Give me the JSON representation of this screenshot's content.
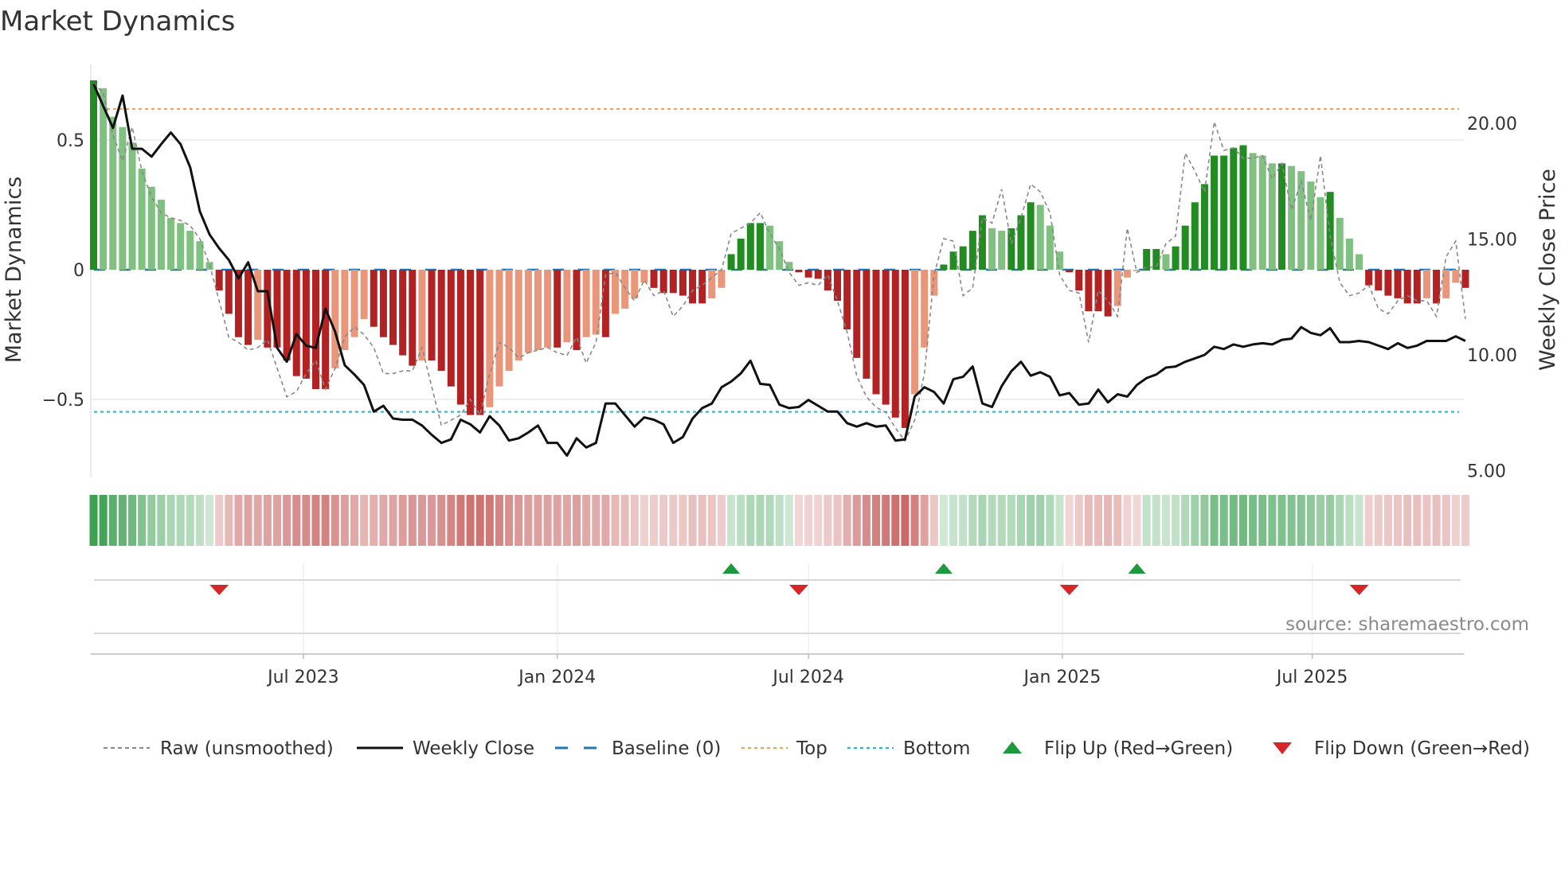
{
  "chart_data": {
    "type": "bar+line",
    "title": "Market Dynamics",
    "ylabel_left": "Market Dynamics",
    "ylabel_right": "Weekly Close Price",
    "frequency": "weekly",
    "start_date": "2023-01-30",
    "ylim_left": [
      -0.8,
      0.79
    ],
    "ylim_right": [
      4.7,
      22.4
    ],
    "yticks_left": [
      {
        "v": 0.5,
        "label": "0.5"
      },
      {
        "v": 0,
        "label": "0"
      },
      {
        "v": -0.5,
        "label": "−0.5"
      }
    ],
    "yticks_right": [
      {
        "v": 20,
        "label": "20.00"
      },
      {
        "v": 15,
        "label": "15.00"
      },
      {
        "v": 10,
        "label": "10.00"
      },
      {
        "v": 5,
        "label": "5.00"
      }
    ],
    "xticks": [
      {
        "date": "2023-07-01",
        "label": "Jul 2023"
      },
      {
        "date": "2024-01-01",
        "label": "Jan 2024"
      },
      {
        "date": "2024-07-01",
        "label": "Jul 2024"
      },
      {
        "date": "2025-01-01",
        "label": "Jan 2025"
      },
      {
        "date": "2025-07-01",
        "label": "Jul 2025"
      }
    ],
    "top_level": 0.62,
    "bottom_level": -0.548,
    "baseline": 0,
    "momentum": [
      0.73,
      0.7,
      0.59,
      0.55,
      0.49,
      0.39,
      0.32,
      0.27,
      0.2,
      0.18,
      0.15,
      0.11,
      0.03,
      -0.08,
      -0.17,
      -0.26,
      -0.29,
      -0.27,
      -0.3,
      -0.3,
      -0.35,
      -0.41,
      -0.42,
      -0.46,
      -0.46,
      -0.38,
      -0.31,
      -0.26,
      -0.19,
      -0.22,
      -0.26,
      -0.29,
      -0.33,
      -0.37,
      -0.35,
      -0.35,
      -0.39,
      -0.45,
      -0.52,
      -0.56,
      -0.56,
      -0.53,
      -0.45,
      -0.39,
      -0.35,
      -0.32,
      -0.31,
      -0.3,
      -0.3,
      -0.28,
      -0.31,
      -0.26,
      -0.25,
      -0.26,
      -0.17,
      -0.15,
      -0.11,
      -0.05,
      -0.07,
      -0.09,
      -0.09,
      -0.1,
      -0.13,
      -0.13,
      -0.11,
      -0.07,
      0.06,
      0.12,
      0.18,
      0.18,
      0.17,
      0.11,
      0.03,
      -0.01,
      -0.03,
      -0.035,
      -0.08,
      -0.12,
      -0.23,
      -0.34,
      -0.42,
      -0.48,
      -0.52,
      -0.57,
      -0.61,
      -0.48,
      -0.3,
      -0.1,
      0.02,
      0.07,
      0.09,
      0.15,
      0.21,
      0.16,
      0.15,
      0.16,
      0.21,
      0.26,
      0.25,
      0.17,
      0.07,
      -0.01,
      -0.08,
      -0.16,
      -0.16,
      -0.18,
      -0.14,
      -0.03,
      -0.005,
      0.08,
      0.08,
      0.06,
      0.09,
      0.17,
      0.26,
      0.33,
      0.44,
      0.44,
      0.47,
      0.48,
      0.45,
      0.44,
      0.41,
      0.41,
      0.4,
      0.38,
      0.34,
      0.28,
      0.3,
      0.2,
      0.12,
      0.06,
      -0.06,
      -0.08,
      -0.1,
      -0.11,
      -0.13,
      -0.13,
      -0.11,
      -0.13,
      -0.11,
      -0.05,
      -0.07
    ],
    "raw": [
      0.72,
      0.68,
      0.52,
      0.42,
      0.55,
      0.38,
      0.28,
      0.22,
      0.2,
      0.19,
      0.17,
      0.12,
      0.02,
      -0.12,
      -0.26,
      -0.28,
      -0.31,
      -0.3,
      -0.27,
      -0.38,
      -0.49,
      -0.47,
      -0.4,
      -0.35,
      -0.46,
      -0.38,
      -0.26,
      -0.22,
      -0.25,
      -0.3,
      -0.4,
      -0.4,
      -0.39,
      -0.39,
      -0.3,
      -0.45,
      -0.6,
      -0.58,
      -0.56,
      -0.5,
      -0.56,
      -0.4,
      -0.28,
      -0.3,
      -0.34,
      -0.32,
      -0.31,
      -0.3,
      -0.32,
      -0.33,
      -0.26,
      -0.36,
      -0.28,
      -0.02,
      -0.01,
      -0.07,
      -0.12,
      -0.04,
      -0.1,
      -0.08,
      -0.18,
      -0.14,
      -0.08,
      -0.06,
      -0.03,
      0.0,
      0.14,
      0.16,
      0.18,
      0.22,
      0.14,
      0.08,
      -0.01,
      -0.06,
      -0.05,
      -0.06,
      -0.02,
      -0.12,
      -0.24,
      -0.41,
      -0.49,
      -0.53,
      -0.55,
      -0.61,
      -0.66,
      -0.58,
      -0.4,
      -0.02,
      0.12,
      0.11,
      -0.1,
      -0.07,
      0.2,
      0.18,
      0.31,
      0.1,
      0.2,
      0.33,
      0.3,
      0.22,
      -0.02,
      -0.08,
      -0.09,
      -0.28,
      -0.08,
      -0.12,
      -0.18,
      0.16,
      -0.01,
      0.01,
      0.01,
      0.1,
      0.13,
      0.45,
      0.38,
      0.3,
      0.57,
      0.46,
      0.47,
      0.43,
      0.43,
      0.44,
      0.35,
      0.41,
      0.23,
      0.34,
      0.19,
      0.44,
      0.13,
      -0.05,
      -0.1,
      -0.09,
      -0.06,
      -0.15,
      -0.17,
      -0.12,
      -0.1,
      -0.12,
      -0.12,
      -0.18,
      0.05,
      0.11,
      -0.19
    ],
    "close": [
      21.7,
      20.75,
      19.8,
      21.2,
      18.9,
      18.9,
      18.56,
      19.1,
      19.6,
      19.1,
      18.1,
      16.2,
      15.2,
      14.6,
      14.1,
      13.3,
      14.0,
      12.75,
      12.75,
      10.3,
      9.7,
      10.9,
      10.4,
      10.3,
      12.0,
      11.0,
      9.55,
      9.15,
      8.7,
      7.55,
      7.8,
      7.25,
      7.2,
      7.2,
      6.95,
      6.55,
      6.2,
      6.35,
      7.2,
      7.0,
      6.65,
      7.35,
      6.95,
      6.3,
      6.4,
      6.65,
      6.95,
      6.2,
      6.2,
      5.65,
      6.4,
      6.0,
      6.2,
      7.9,
      7.9,
      7.4,
      6.9,
      7.3,
      7.2,
      7.0,
      6.2,
      6.45,
      7.25,
      7.7,
      7.9,
      8.6,
      8.85,
      9.2,
      9.75,
      8.75,
      8.7,
      7.85,
      7.7,
      7.75,
      8.05,
      7.8,
      7.55,
      7.55,
      7.05,
      6.9,
      7.05,
      6.9,
      6.95,
      6.3,
      6.35,
      8.2,
      8.6,
      8.4,
      7.9,
      8.95,
      9.05,
      9.5,
      7.9,
      7.75,
      8.65,
      9.3,
      9.7,
      9.1,
      9.25,
      9.05,
      8.25,
      8.35,
      7.85,
      7.9,
      8.5,
      7.95,
      8.3,
      8.2,
      8.7,
      9.0,
      9.15,
      9.45,
      9.5,
      9.7,
      9.85,
      10.0,
      10.35,
      10.25,
      10.45,
      10.35,
      10.45,
      10.5,
      10.45,
      10.65,
      10.7,
      11.2,
      10.95,
      10.85,
      11.15,
      10.55,
      10.55,
      10.6,
      10.55,
      10.4,
      10.25,
      10.5,
      10.3,
      10.4,
      10.6,
      10.6,
      10.6,
      10.8,
      10.6
    ],
    "flips_up": [
      "2024-05-06",
      "2024-10-07",
      "2025-02-24"
    ],
    "flips_down": [
      "2023-05-01",
      "2024-06-24",
      "2025-01-06",
      "2025-08-04"
    ],
    "legend": [
      {
        "key": "raw",
        "label": "Raw (unsmoothed)"
      },
      {
        "key": "close",
        "label": "Weekly Close"
      },
      {
        "key": "baseline",
        "label": "Baseline (0)"
      },
      {
        "key": "top",
        "label": "Top"
      },
      {
        "key": "bottom",
        "label": "Bottom"
      },
      {
        "key": "flip_up",
        "label": "Flip Up (Red→Green)"
      },
      {
        "key": "flip_down",
        "label": "Flip Down (Green→Red)"
      }
    ],
    "legend_position": "bottom",
    "source": "source: sharemaestro.com"
  },
  "colors": {
    "green_strong": "#228b22",
    "green_weak": "#80c080",
    "red_strong": "#b22222",
    "red_weak": "#e9967a",
    "close": "#111111",
    "raw": "#888888",
    "baseline": "#1f77b4",
    "top": "#f0a050",
    "bottom": "#17becf",
    "flip_up": "#1a9a3a",
    "flip_down": "#d62728"
  }
}
